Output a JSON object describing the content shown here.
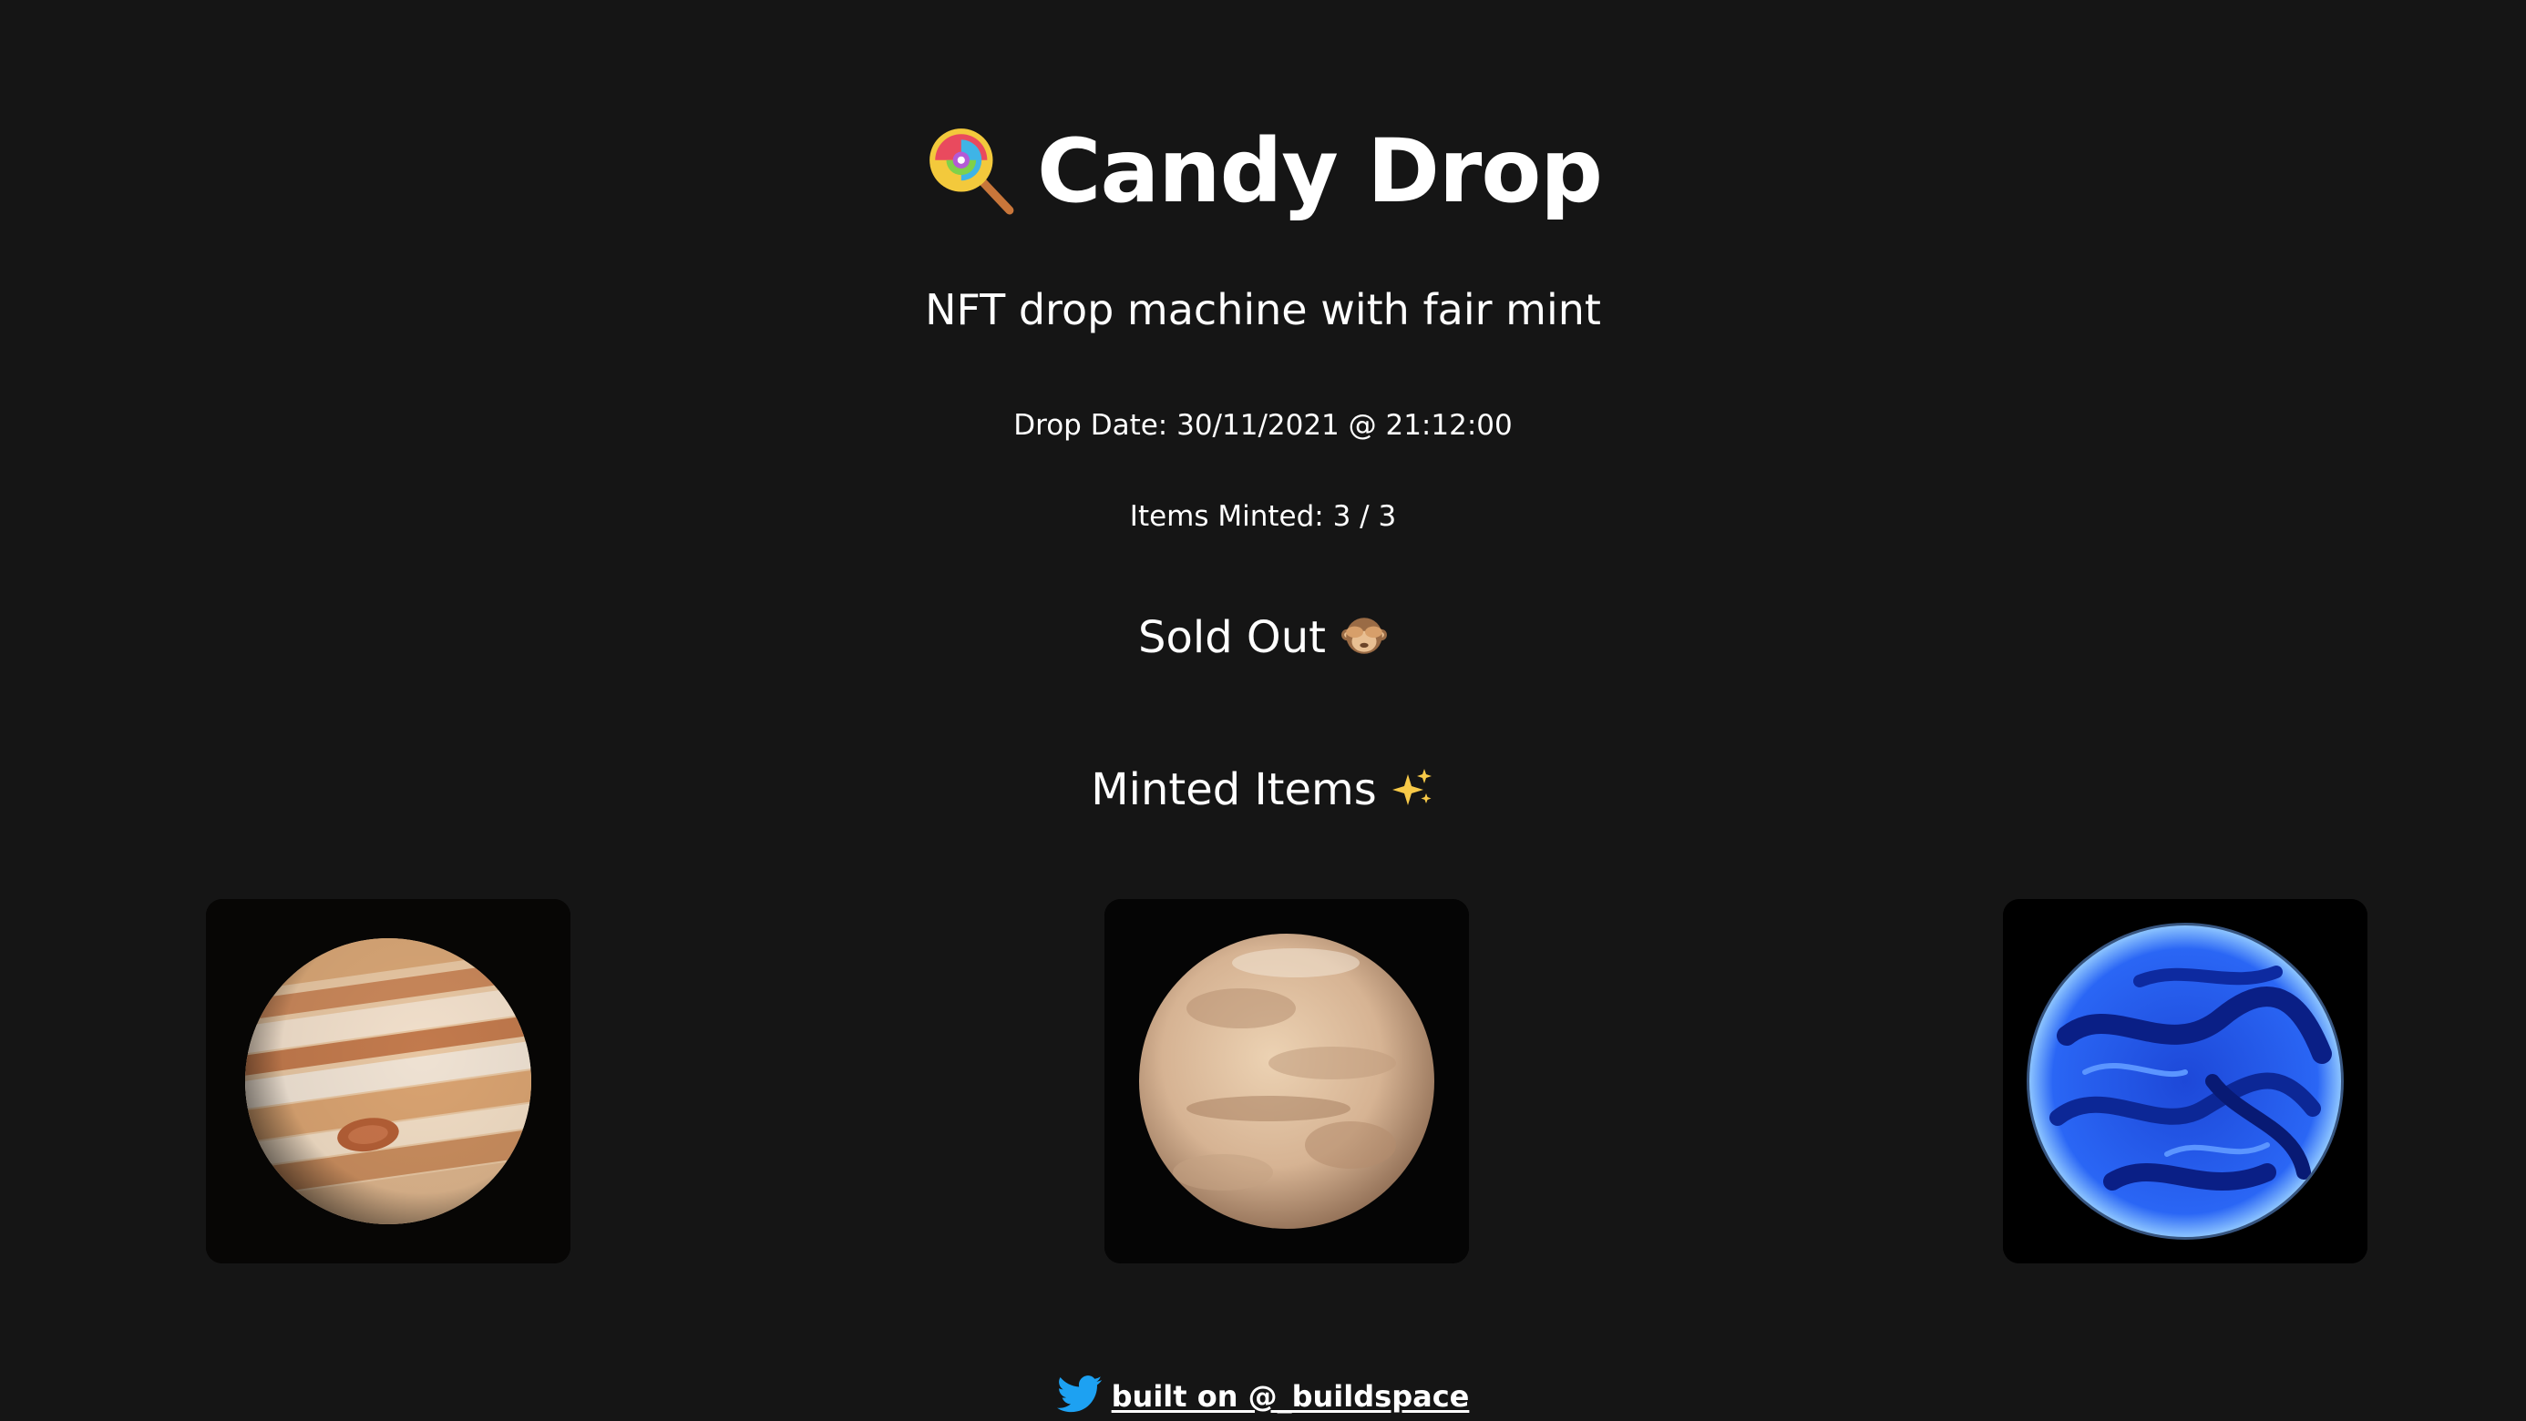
{
  "header": {
    "title": "Candy Drop",
    "title_icon": "lollipop-icon",
    "subtitle": "NFT drop machine with fair mint"
  },
  "drop": {
    "date_text": "Drop Date: 30/11/2021 @ 21:12:00",
    "minted_text": "Items Minted: 3 / 3",
    "status_text": "Sold Out",
    "status_icon": "see-no-evil-monkey-icon"
  },
  "gallery": {
    "heading": "Minted Items",
    "heading_icon": "sparkles-icon",
    "items": [
      {
        "name": "jupiter",
        "colors": [
          "#d9a877",
          "#f2e2cf",
          "#b7693f"
        ]
      },
      {
        "name": "mars",
        "colors": [
          "#d8b48f",
          "#f0d6b5",
          "#a98263"
        ]
      },
      {
        "name": "blue-planet",
        "colors": [
          "#2f6bff",
          "#0a2a9c",
          "#7ab8ff"
        ]
      }
    ]
  },
  "footer": {
    "link_text": "built on @_buildspace",
    "icon": "twitter-bird-icon",
    "icon_color": "#1da1f2"
  }
}
